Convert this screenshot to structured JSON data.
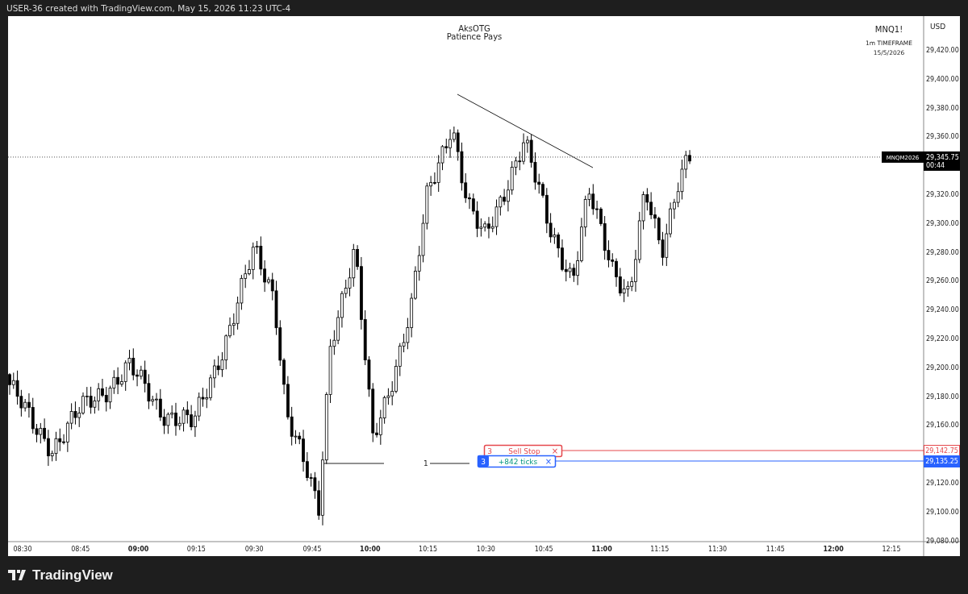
{
  "header": {
    "caption": "USER-36 created with TradingView.com, May 15, 2026 11:23 UTC-4"
  },
  "chart": {
    "title": "AksOTG",
    "subtitle": "Patience Pays",
    "symbol": "MNQ1!",
    "timeframe": "1m TIMEFRAME",
    "date": "15/5/2026",
    "currency": "USD",
    "price_labels": [
      "29,420.00",
      "29,400.00",
      "29,380.00",
      "29,360.00",
      "29,320.00",
      "29,300.00",
      "29,280.00",
      "29,260.00",
      "29,240.00",
      "29,220.00",
      "29,200.00",
      "29,180.00",
      "29,160.00",
      "29,120.00",
      "29,100.00",
      "29,080.00"
    ],
    "time_labels": [
      {
        "label": "08:30",
        "bold": false
      },
      {
        "label": "08:45",
        "bold": false
      },
      {
        "label": "09:00",
        "bold": true
      },
      {
        "label": "09:15",
        "bold": false
      },
      {
        "label": "09:30",
        "bold": false
      },
      {
        "label": "09:45",
        "bold": false
      },
      {
        "label": "10:00",
        "bold": true
      },
      {
        "label": "10:15",
        "bold": false
      },
      {
        "label": "10:30",
        "bold": false
      },
      {
        "label": "10:45",
        "bold": false
      },
      {
        "label": "11:00",
        "bold": true
      },
      {
        "label": "11:15",
        "bold": false
      },
      {
        "label": "11:30",
        "bold": false
      },
      {
        "label": "11:45",
        "bold": false
      },
      {
        "label": "12:00",
        "bold": true
      },
      {
        "label": "12:15",
        "bold": false
      }
    ],
    "last_price": {
      "symbol": "MNQM2026",
      "price": "29,345.75",
      "countdown": "00:44"
    },
    "orders": [
      {
        "kind": "stop",
        "quantity": "3",
        "label": "Sell Stop",
        "close": "×",
        "price": "29,142.75",
        "color": "#e5484d"
      },
      {
        "kind": "position",
        "quantity": "3",
        "label": "+842 ticks",
        "close": "×",
        "price": "29,135.25",
        "color": "#2962ff"
      }
    ],
    "level_label": "1"
  },
  "footer": {
    "logo": "TradingView"
  }
}
